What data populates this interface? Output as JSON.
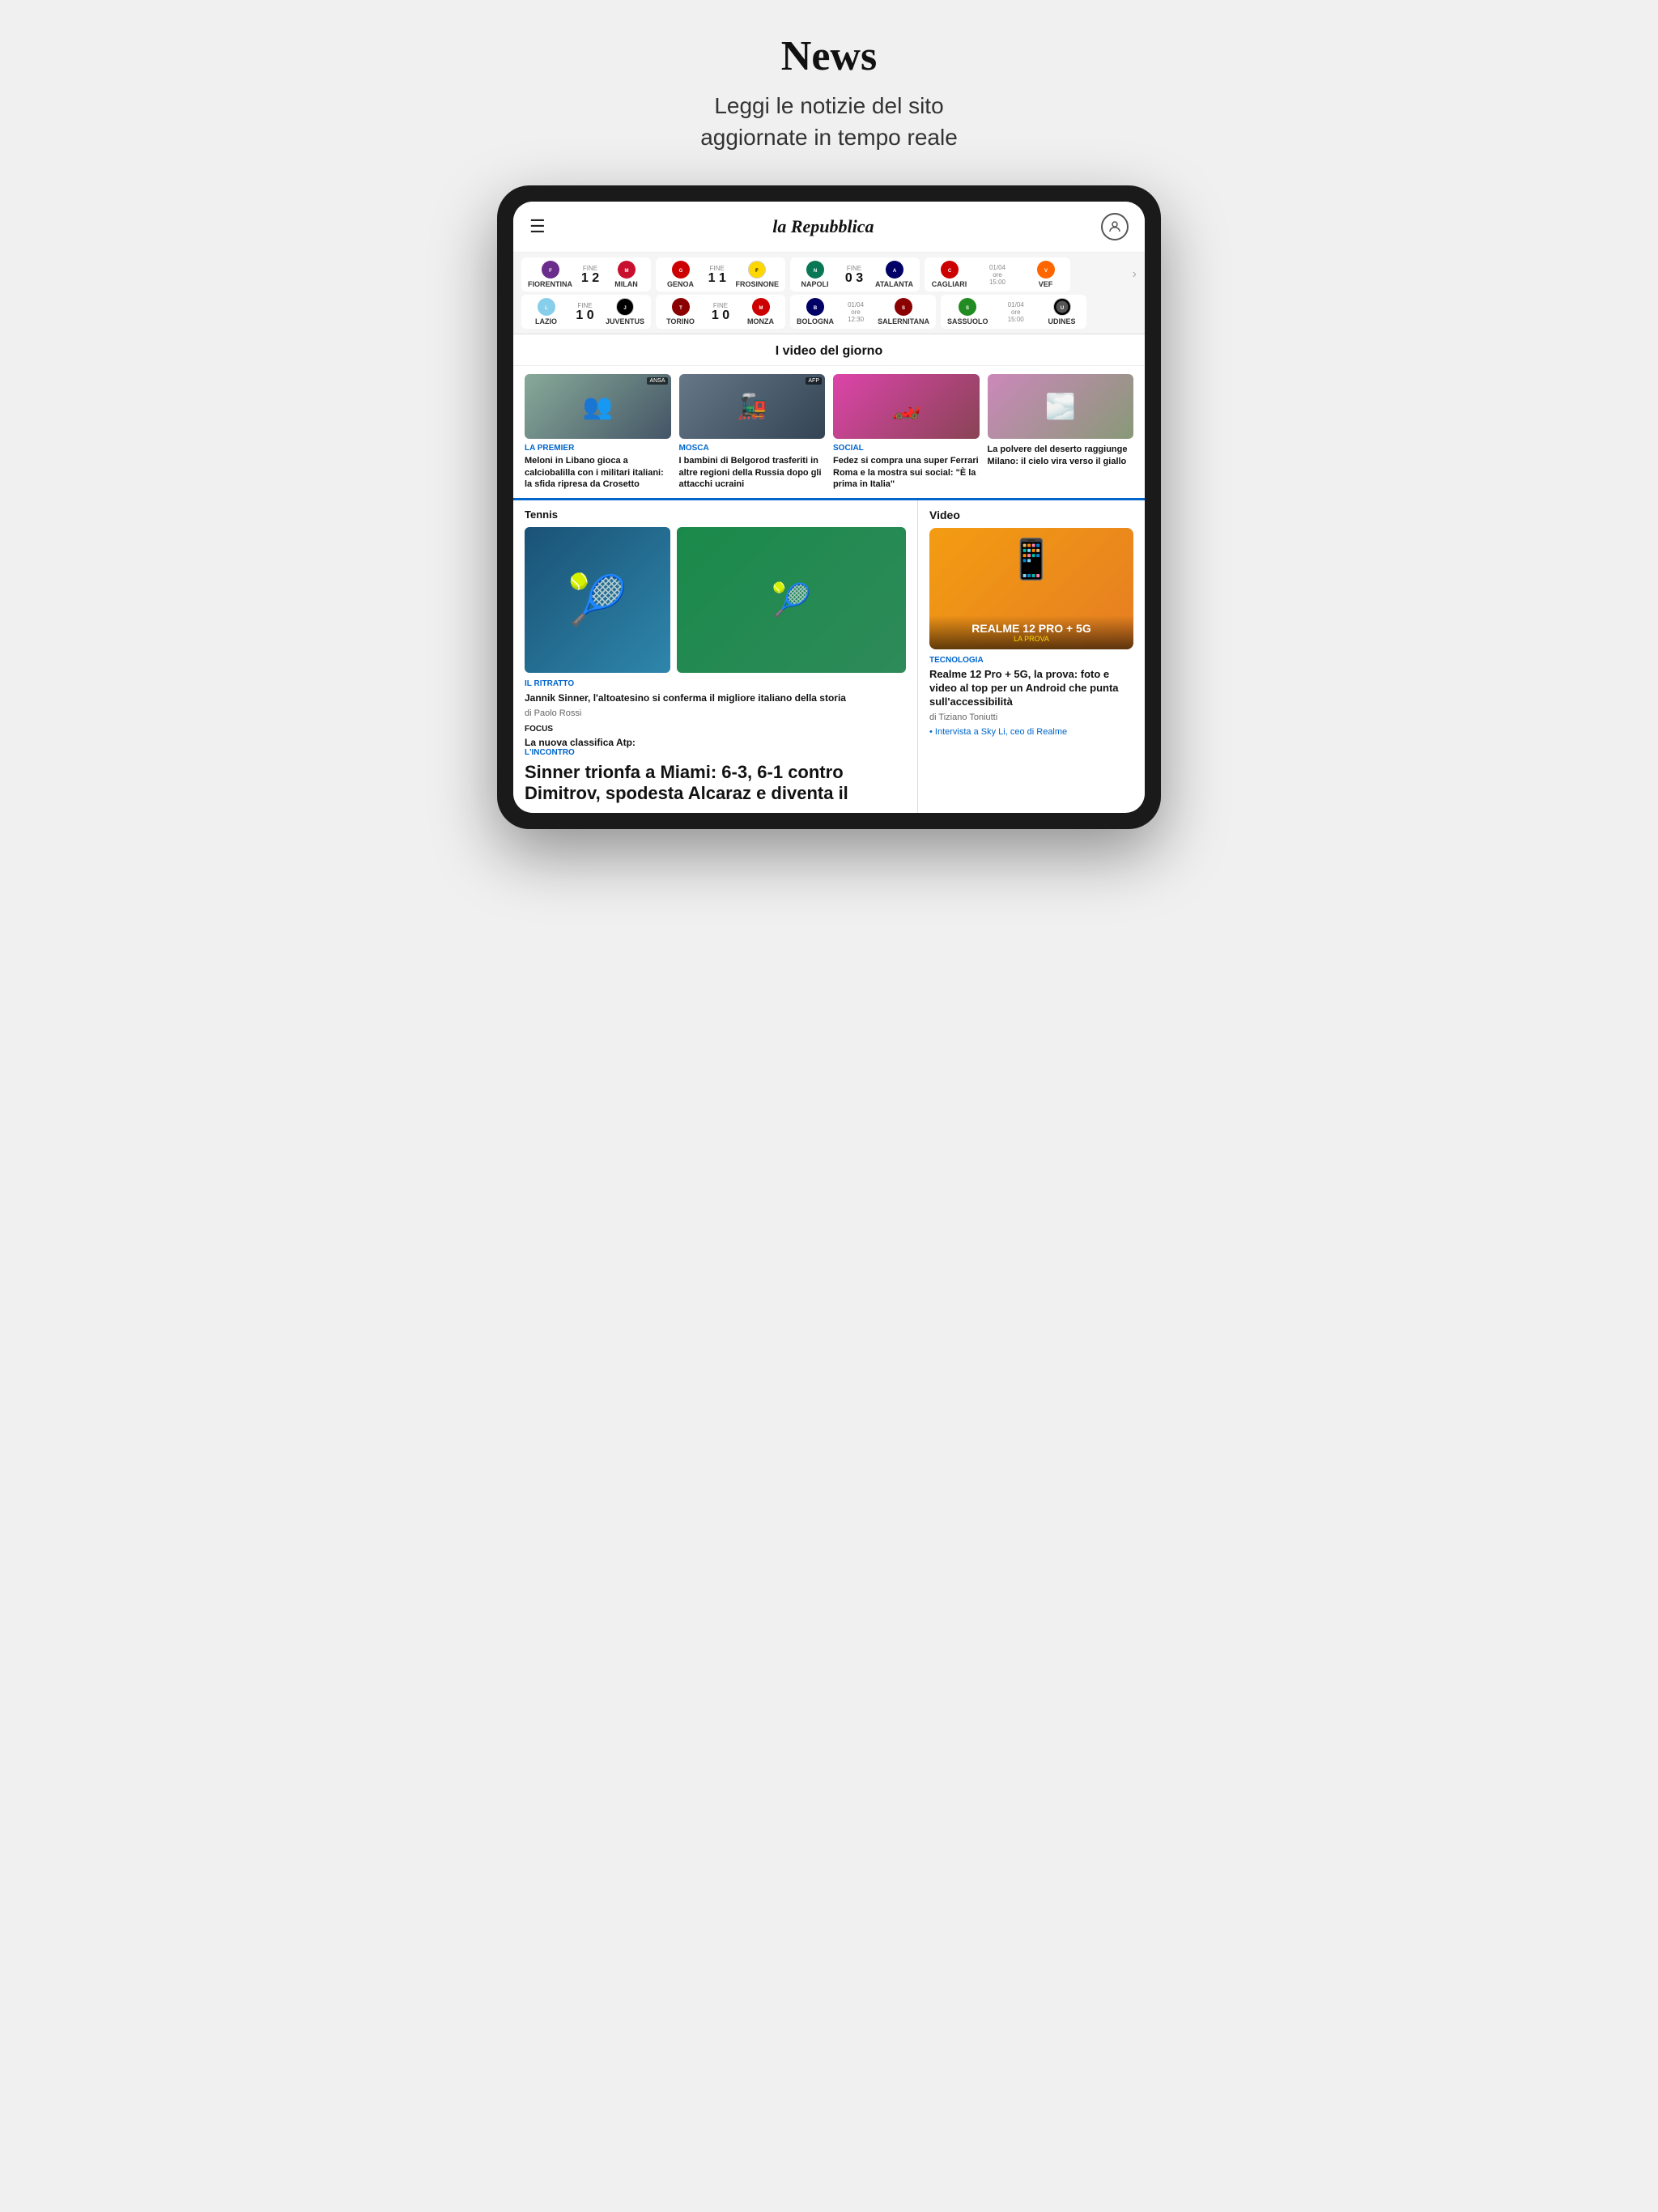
{
  "header": {
    "title": "News",
    "subtitle": "Leggi le notizie del sito\naggiornate in tempo reale"
  },
  "app": {
    "brand": "la Repubblica"
  },
  "scores": {
    "row1": [
      {
        "team1": "FIORENTINA",
        "badge1": "FIO",
        "color1": "#6b2d8b",
        "status": "FINE",
        "score": "1 2",
        "team2": "MILAN",
        "badge2": "MIL",
        "color2": "#c8102e"
      },
      {
        "team1": "GENOA",
        "badge1": "GEN",
        "color1": "#cc0000",
        "status": "FINE",
        "score": "1 1",
        "team2": "FROSINONE",
        "badge2": "FRO",
        "color2": "#ffd700"
      },
      {
        "team1": "NAPOLI",
        "badge1": "NAP",
        "color1": "#087755",
        "status": "FINE",
        "score": "0 3",
        "team2": "ATALANTA",
        "badge2": "ATA",
        "color2": "#000066"
      },
      {
        "team1": "CAGLIARI",
        "badge1": "CAG",
        "color1": "#cc0000",
        "status_date": "01/04",
        "status_time": "ore 15:00",
        "score": "",
        "team2": "VEF",
        "badge2": "VEF",
        "color2": "#ff6600"
      }
    ],
    "row2": [
      {
        "team1": "LAZIO",
        "badge1": "LAZ",
        "color1": "#87ceeb",
        "status": "FINE",
        "score": "1 0",
        "team2": "JUVENTUS",
        "badge2": "JUV",
        "color2": "#000"
      },
      {
        "team1": "TORINO",
        "badge1": "TOR",
        "color1": "#8b0000",
        "status": "FINE",
        "score": "1 0",
        "team2": "MONZA",
        "badge2": "MON",
        "color2": "#cc0000"
      },
      {
        "team1": "BOLOGNA",
        "badge1": "BOL",
        "color1": "#000066",
        "status_date": "01/04",
        "status_time": "ore 12:30",
        "score": "",
        "team2": "SALERNITANA",
        "badge2": "SAL",
        "color2": "#8b0000"
      },
      {
        "team1": "SASSUOLO",
        "badge1": "SAS",
        "color1": "#228b22",
        "status_date": "01/04",
        "status_time": "ore 15:00",
        "score": "",
        "team2": "UDINES",
        "badge2": "UDI",
        "color2": "#000"
      }
    ]
  },
  "video_section": {
    "title": "I video del giorno",
    "items": [
      {
        "category": "LA PREMIER",
        "headline": "Meloni in Libano gioca a calciobalilla con i militari italiani: la sfida ripresa da Crosetto"
      },
      {
        "category": "MOSCA",
        "headline": "I bambini di Belgorod trasferiti in altre regioni della Russia dopo gli attacchi ucraini"
      },
      {
        "category": "SOCIAL",
        "headline": "Fedez si compra una super Ferrari Roma e la mostra sui social: \"È la prima in Italia\""
      },
      {
        "category": "",
        "headline": "La polvere del deserto raggiunge Milano: il cielo vira verso il giallo"
      }
    ]
  },
  "tennis_section": {
    "label": "Tennis",
    "sub_category": "IL RITRATTO",
    "sub_headline": "Jannik Sinner, l'altoatesino si conferma il migliore italiano della storia",
    "author": "di Paolo Rossi",
    "focus_label": "FOCUS",
    "focus_text": "La nuova classifica Atp:",
    "main_category": "L'INCONTRO",
    "main_headline": "Sinner trionfa a Miami: 6-3, 6-1 contro Dimitrov, spodesta Alcaraz e diventa il"
  },
  "video_right": {
    "label": "Video",
    "feature_title": "REALME 12 PRO + 5G",
    "feature_subtitle": "LA PROVA",
    "category": "TECNOLOGIA",
    "headline": "Realme 12 Pro + 5G, la prova: foto e video al top per un Android che punta sull'accessibilità",
    "author": "di Tiziano Toniutti",
    "bullet": "Intervista a Sky Li, ceo di Realme"
  }
}
